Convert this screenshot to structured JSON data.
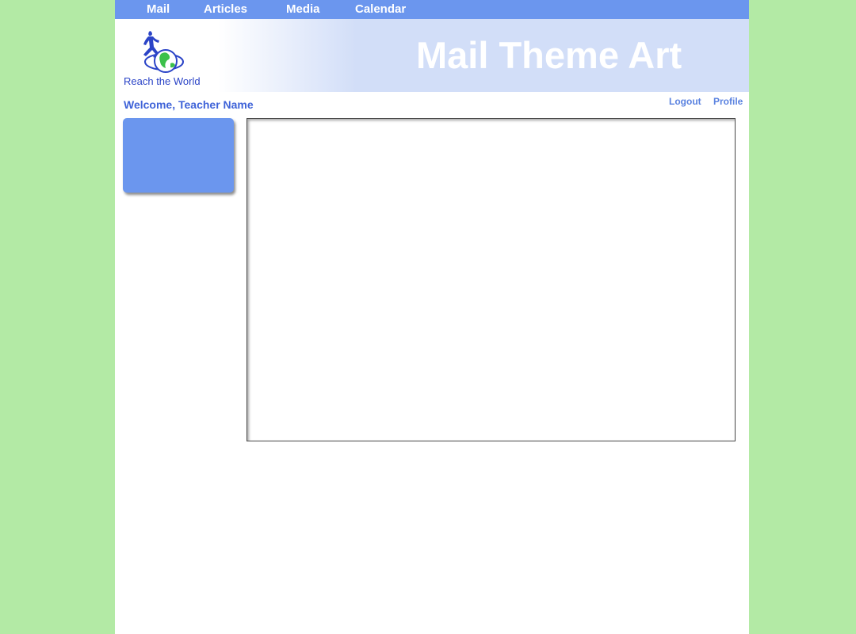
{
  "nav": {
    "items": [
      {
        "label": "Mail"
      },
      {
        "label": "Articles"
      },
      {
        "label": "Media"
      },
      {
        "label": "Calendar"
      }
    ]
  },
  "banner": {
    "logo_text": "Reach the World",
    "title": "Mail Theme Art"
  },
  "user": {
    "welcome": "Welcome, Teacher Name",
    "logout_label": "Logout",
    "profile_label": "Profile"
  },
  "colors": {
    "outer_background": "#b3eaa5",
    "nav_bar": "#6b96ee",
    "banner_light": "#d2def8",
    "welcome_text": "#3f63d8",
    "link_text": "#5a82e0",
    "sidebar_box": "#6b96ee"
  },
  "icons": {
    "logo": "globe-with-runner-logo"
  }
}
